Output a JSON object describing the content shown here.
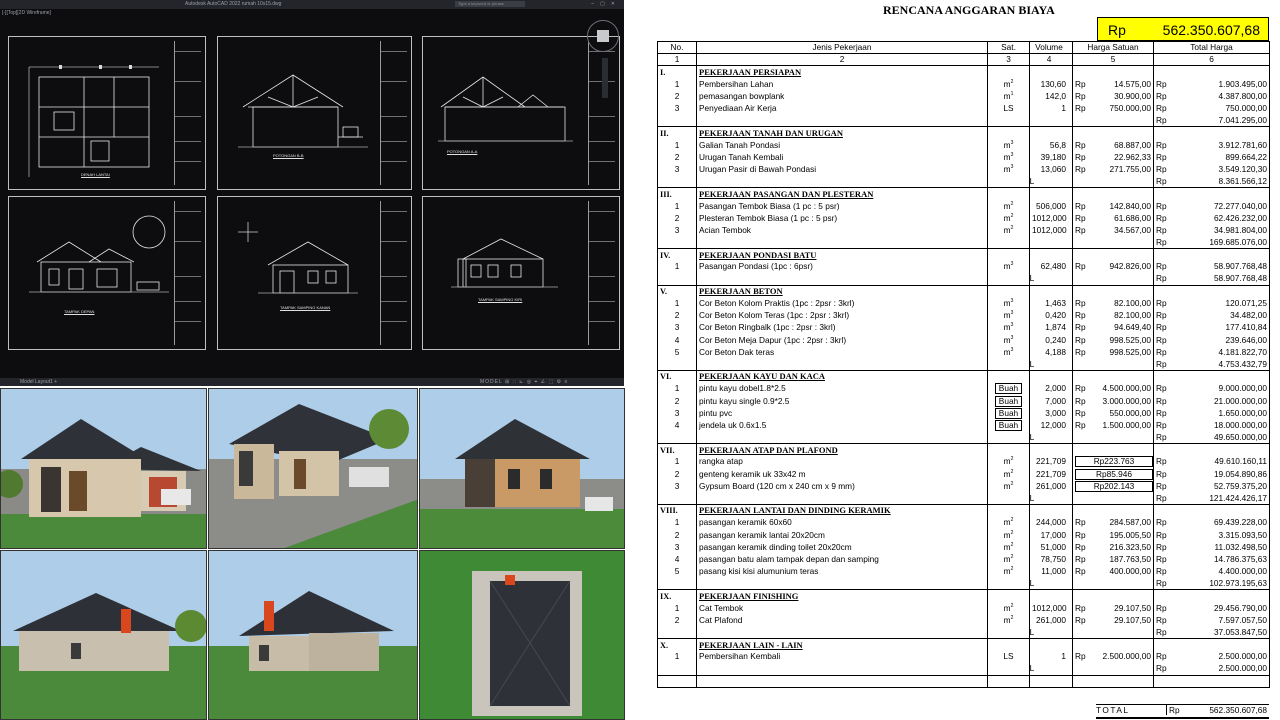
{
  "cad": {
    "title": "Autodesk AutoCAD 2022  rumah 10x15.dwg",
    "search": "Type a keyword or phrase",
    "viewport_label": "[-][Top][2D Wireframe]",
    "sheet_labels": [
      "DENAH LANTAI",
      "POTONGAN B-B",
      "POTONGAN A-A",
      "TAMPAK DEPAN",
      "TAMPAK SAMPING KANAN",
      "TAMPAK SAMPING KIRI"
    ],
    "status_tabs": "Model  Layout1  +",
    "status_icons": "MODEL ⊞ ∷ ⊾ ◎ ⌖ ∠ ⬚ ⚙ ≡"
  },
  "rab": {
    "title": "RENCANA ANGGARAN BIAYA",
    "grand_total_currency": "Rp",
    "grand_total_value": "562.350.607,68",
    "headers": {
      "no": "No.",
      "jenis": "Jenis Pekerjaan",
      "sat": "Sat.",
      "vol": "Volume",
      "hs": "Harga Satuan",
      "th": "Total Harga"
    },
    "header_numbers": [
      "1",
      "2",
      "3",
      "4",
      "5",
      "6"
    ],
    "total_label": "TOTAL",
    "rp": "Rp",
    "sections": [
      {
        "no": "I.",
        "name": "PEKERJAAN PERSIAPAN",
        "total_label_shown": false,
        "total": "7.041.295,00",
        "items": [
          {
            "no": "1",
            "name": "Pembersihan Lahan",
            "sat": "m2",
            "vol": "130,60",
            "hs": "14.575,00",
            "th": "1.903.495,00"
          },
          {
            "no": "2",
            "name": "pemasangan bowplank",
            "sat": "m1",
            "vol": "142,0",
            "hs": "30.900,00",
            "th": "4.387.800,00"
          },
          {
            "no": "3",
            "name": "Penyediaan Air Kerja",
            "sat": "LS",
            "vol": "1",
            "hs": "750.000,00",
            "th": "750.000,00"
          }
        ]
      },
      {
        "no": "II.",
        "name": "PEKERJAAN TANAH DAN URUGAN",
        "total_label_shown": true,
        "total": "8.361.566,12",
        "items": [
          {
            "no": "1",
            "name": "Galian Tanah Pondasi",
            "sat": "m3",
            "vol": "56,8",
            "hs": "68.887,00",
            "th": "3.912.781,60"
          },
          {
            "no": "2",
            "name": "Urugan Tanah Kembali",
            "sat": "m3",
            "vol": "39,180",
            "hs": "22.962,33",
            "th": "899.664,22"
          },
          {
            "no": "3",
            "name": "Urugan Pasir di Bawah Pondasi",
            "sat": "m3",
            "vol": "13,060",
            "hs": "271.755,00",
            "th": "3.549.120,30"
          }
        ]
      },
      {
        "no": "III.",
        "name": "PEKERJAAN PASANGAN DAN PLESTERAN",
        "total_label_shown": false,
        "total": "169.685.076,00",
        "items": [
          {
            "no": "1",
            "name": "Pasangan Tembok Biasa (1 pc : 5 psr)",
            "sat": "m2",
            "vol": "506,000",
            "hs": "142.840,00",
            "th": "72.277.040,00"
          },
          {
            "no": "2",
            "name": "Plesteran Tembok Biasa (1 pc : 5 psr)",
            "sat": "m2",
            "vol": "1012,000",
            "hs": "61.686,00",
            "th": "62.426.232,00"
          },
          {
            "no": "3",
            "name": "Acian Tembok",
            "sat": "m2",
            "vol": "1012,000",
            "hs": "34.567,00",
            "th": "34.981.804,00"
          }
        ]
      },
      {
        "no": "IV.",
        "name": "PEKERJAAN PONDASI BATU",
        "total_label_shown": true,
        "total": "58.907.768,48",
        "items": [
          {
            "no": "1",
            "name": "Pasangan Pondasi (1pc : 6psr)",
            "sat": "m3",
            "vol": "62,480",
            "hs": "942.826,00",
            "th": "58.907.768,48"
          }
        ]
      },
      {
        "no": "V.",
        "name": "PEKERJAAN BETON",
        "total_label_shown": true,
        "total": "4.753.432,79",
        "items": [
          {
            "no": "1",
            "name": "Cor Beton Kolom Praktis (1pc : 2psr : 3krl)",
            "sat": "m3",
            "vol": "1,463",
            "hs": "82.100,00",
            "th": "120.071,25"
          },
          {
            "no": "2",
            "name": "Cor Beton Kolom Teras (1pc : 2psr : 3krl)",
            "sat": "m3",
            "vol": "0,420",
            "hs": "82.100,00",
            "th": "34.482,00"
          },
          {
            "no": "3",
            "name": "Cor Beton Ringbalk (1pc : 2psr : 3krl)",
            "sat": "m3",
            "vol": "1,874",
            "hs": "94.649,40",
            "th": "177.410,84"
          },
          {
            "no": "4",
            "name": "Cor Beton Meja Dapur (1pc : 2psr : 3krl)",
            "sat": "m3",
            "vol": "0,240",
            "hs": "998.525,00",
            "th": "239.646,00"
          },
          {
            "no": "5",
            "name": "Cor Beton Dak teras",
            "sat": "m3",
            "vol": "4,188",
            "hs": "998.525,00",
            "th": "4.181.822,70"
          }
        ]
      },
      {
        "no": "VI.",
        "name": "PEKERJAAN KAYU DAN KACA",
        "total_label_shown": true,
        "total": "49.650.000,00",
        "items": [
          {
            "no": "1",
            "name": "pintu kayu dobel1.8*2.5",
            "sat": "Buah",
            "vol": "2,000",
            "hs": "4.500.000,00",
            "th": "9.000.000,00",
            "boxed": true
          },
          {
            "no": "2",
            "name": "pintu kayu single 0.9*2.5",
            "sat": "Buah",
            "vol": "7,000",
            "hs": "3.000.000,00",
            "th": "21.000.000,00",
            "boxed": true
          },
          {
            "no": "3",
            "name": "pintu pvc",
            "sat": "Buah",
            "vol": "3,000",
            "hs": "550.000,00",
            "th": "1.650.000,00",
            "boxed": true
          },
          {
            "no": "4",
            "name": " jendela uk 0.6x1.5",
            "sat": "Buah",
            "vol": "12,000",
            "hs": "1.500.000,00",
            "th": "18.000.000,00",
            "boxed": true
          }
        ]
      },
      {
        "no": "VII.",
        "name": "PEKERJAAN ATAP DAN PLAFOND",
        "total_label_shown": true,
        "total": "121.424.426,17",
        "items": [
          {
            "no": "1",
            "name": "rangka atap",
            "sat": "m2",
            "vol": "221,709",
            "hs": "Rp223.763",
            "th": "49.610.160,11",
            "hsbox": true
          },
          {
            "no": "2",
            "name": "genteng keramik  uk 33x42 m",
            "sat": "m2",
            "vol": "221,709",
            "hs": "Rp85.946",
            "th": "19.054.890,86",
            "hsbox": true
          },
          {
            "no": "3",
            "name": "Gypsum Board (120 cm x 240 cm x 9 mm)",
            "sat": "m2",
            "vol": "261,000",
            "hs": "Rp202.143",
            "th": "52.759.375,20",
            "hsbox": true
          }
        ]
      },
      {
        "no": "VIII.",
        "name": "PEKERJAAN LANTAI DAN DINDING KERAMIK",
        "total_label_shown": true,
        "total": "102.973.195,63",
        "items": [
          {
            "no": "1",
            "name": "pasangan keramik 60x60",
            "sat": "m2",
            "vol": "244,000",
            "hs": "284.587,00",
            "th": "69.439.228,00"
          },
          {
            "no": "2",
            "name": "pasangan keramik lantai 20x20cm",
            "sat": "m2",
            "vol": "17,000",
            "hs": "195.005,50",
            "th": "3.315.093,50"
          },
          {
            "no": "3",
            "name": "pasangan keramik dinding toilet 20x20cm",
            "sat": "m2",
            "vol": "51,000",
            "hs": "216.323,50",
            "th": "11.032.498,50"
          },
          {
            "no": "4",
            "name": "pasangan batu alam tampak depan dan samping",
            "sat": "m2",
            "vol": "78,750",
            "hs": "187.763,50",
            "th": "14.786.375,63"
          },
          {
            "no": "5",
            "name": "pasang kisi kisi alumunium teras",
            "sat": "m2",
            "vol": "11,000",
            "hs": "400.000,00",
            "th": "4.400.000,00"
          }
        ]
      },
      {
        "no": "IX.",
        "name": "PEKERJAAN FINISHING",
        "total_label_shown": true,
        "total": "37.053.847,50",
        "items": [
          {
            "no": "1",
            "name": "Cat Tembok",
            "sat": "m2",
            "vol": "1012,000",
            "hs": "29.107,50",
            "th": "29.456.790,00"
          },
          {
            "no": "2",
            "name": "Cat Plafond",
            "sat": "m2",
            "vol": "261,000",
            "hs": "29.107,50",
            "th": "7.597.057,50"
          }
        ]
      },
      {
        "no": "X.",
        "name": "PEKERJAAN LAIN - LAIN",
        "total_label_shown": true,
        "total": "2.500.000,00",
        "gap_after": true,
        "items": [
          {
            "no": "1",
            "name": "Pembersihan Kembali",
            "sat": "LS",
            "vol": "1",
            "hs": "2.500.000,00",
            "th": "2.500.000,00"
          }
        ]
      }
    ],
    "grand_bottom_label": "TOTAL",
    "grand_bottom_value": "562.350.607,68"
  }
}
